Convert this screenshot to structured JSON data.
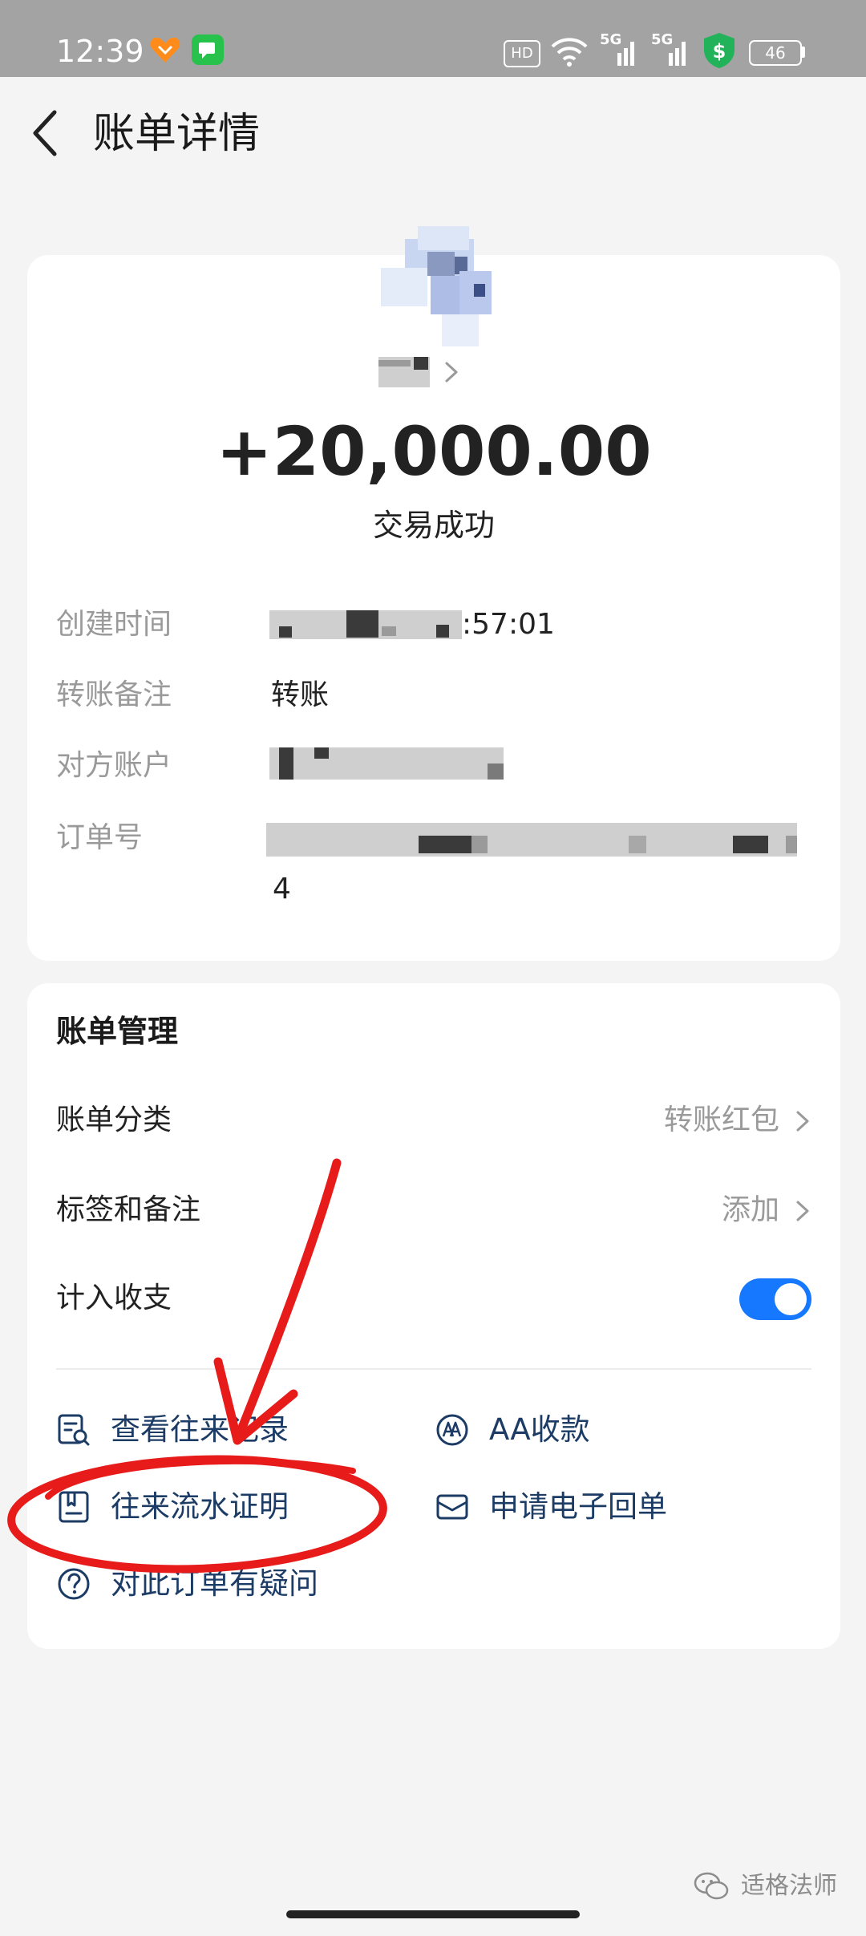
{
  "status_bar": {
    "time": "12:39",
    "hd_label": "HD",
    "network_1": "5G",
    "network_2": "5G",
    "battery": "46",
    "icons": [
      "heart-app-icon",
      "message-app-icon",
      "hd-voice-icon",
      "wifi-icon",
      "signal-icon",
      "signal-icon",
      "shield-dollar-icon",
      "battery-icon"
    ]
  },
  "header": {
    "title": "账单详情",
    "back_icon": "chevron-left-icon"
  },
  "summary": {
    "amount": "+20,000.00",
    "status": "交易成功",
    "details": [
      {
        "label": "创建时间",
        "value_suffix": ":57:01"
      },
      {
        "label": "转账备注",
        "value": "转账"
      },
      {
        "label": "对方账户",
        "value": ""
      },
      {
        "label": "订单号",
        "value_suffix": "4"
      }
    ]
  },
  "manage": {
    "title": "账单管理",
    "rows": [
      {
        "label": "账单分类",
        "value": "转账红包"
      },
      {
        "label": "标签和备注",
        "value": "添加"
      },
      {
        "label": "计入收支",
        "toggle_on": true
      }
    ],
    "actions": [
      {
        "label": "查看往来记录",
        "icon": "record-search-icon"
      },
      {
        "label": "AA收款",
        "icon": "aa-collect-icon"
      },
      {
        "label": "往来流水证明",
        "icon": "statement-proof-icon"
      },
      {
        "label": "申请电子回单",
        "icon": "envelope-icon"
      },
      {
        "label": "对此订单有疑问",
        "icon": "question-icon"
      }
    ]
  },
  "watermark": {
    "text": "适格法师"
  },
  "colors": {
    "accent": "#1677ff",
    "action_text": "#1c3c66",
    "annotation_red": "#e81b1b"
  }
}
